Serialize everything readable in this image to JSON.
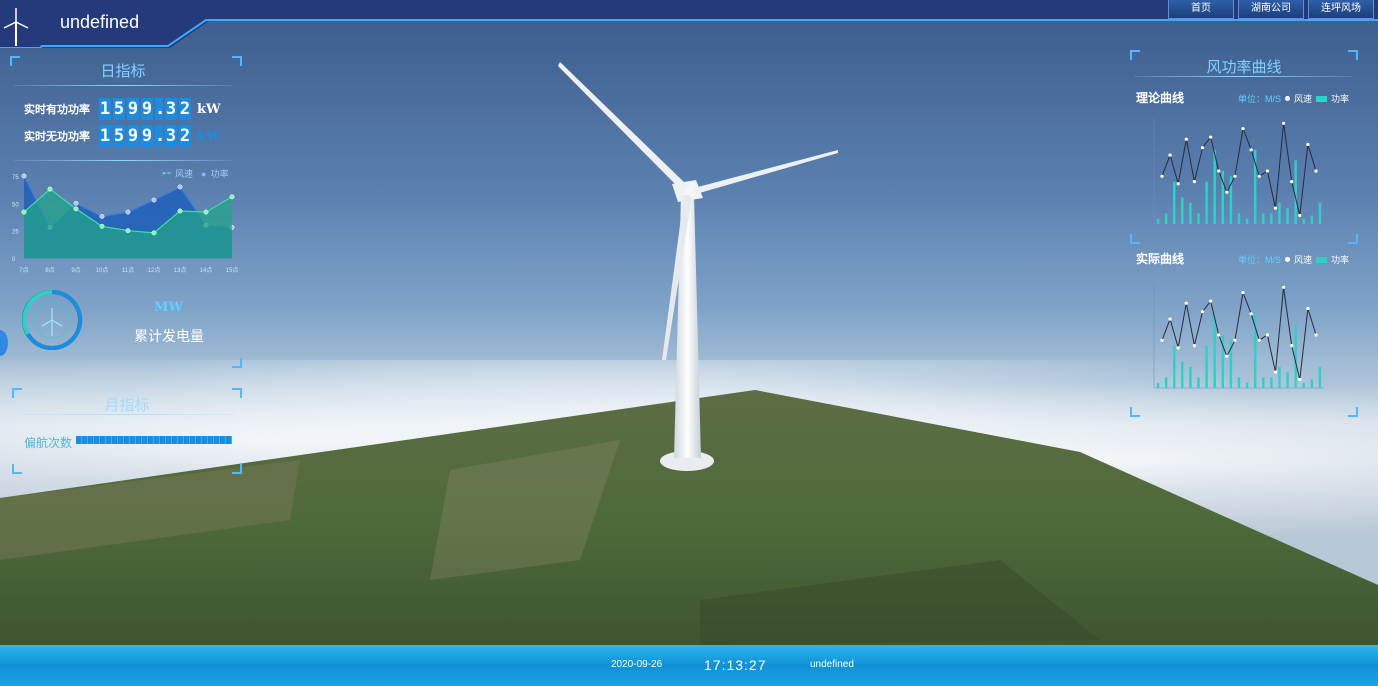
{
  "header": {
    "title": "undefined",
    "nav": [
      "首页",
      "湖南公司",
      "连坪风场"
    ]
  },
  "left_panel": {
    "daily_title": "日指标",
    "metrics": [
      {
        "label": "实时有功功率",
        "digits": [
          "1",
          "5",
          "9",
          "9",
          ".",
          "3",
          "2"
        ],
        "unit": "kW"
      },
      {
        "label": "实时无功功率",
        "digits": [
          "1",
          "5",
          "9",
          "9",
          ".",
          "3",
          "2"
        ],
        "unit": "kW"
      }
    ],
    "chart_data": {
      "type": "area",
      "categories": [
        "7点",
        "8点",
        "9点",
        "10点",
        "11点",
        "12点",
        "13点",
        "14点",
        "15点"
      ],
      "series": [
        {
          "name": "风速",
          "values": [
            75,
            28,
            50,
            38,
            42,
            53,
            65,
            30,
            28
          ]
        },
        {
          "name": "功率",
          "values": [
            42,
            63,
            45,
            29,
            25,
            23,
            43,
            42,
            56
          ]
        }
      ],
      "ylim": [
        0,
        75
      ],
      "yticks": [
        "0",
        "25",
        "50",
        "75"
      ]
    },
    "gauge_unit": "MW",
    "gauge_label": "累计发电量",
    "monthly_title": "月指标",
    "yaw_label": "偏航次数"
  },
  "right_panel": {
    "title": "风功率曲线",
    "unit_label": "单位：M/S",
    "legend_speed": "风速",
    "legend_power": "功率",
    "theory_title": "理论曲线",
    "actual_title": "实际曲线"
  },
  "footer": {
    "date": "2020-09-26",
    "time": "17:13:27",
    "status": "undefined"
  },
  "colors": {
    "accent": "#7fd3ff",
    "digit_bg": "#1b8de0",
    "teal": "#2ed1c8",
    "footer": "#1a9fe0"
  }
}
